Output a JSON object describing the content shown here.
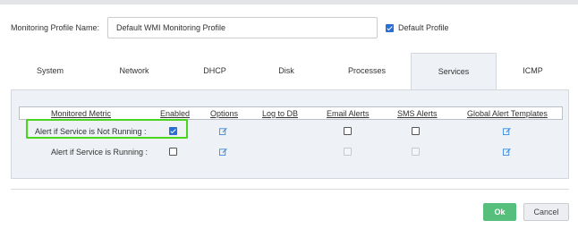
{
  "profile": {
    "name_label": "Monitoring Profile Name:",
    "name_value": "Default WMI Monitoring Profile",
    "default_label": "Default Profile",
    "default_checked": true
  },
  "tabs": [
    {
      "label": "System",
      "active": false
    },
    {
      "label": "Network",
      "active": false
    },
    {
      "label": "DHCP",
      "active": false
    },
    {
      "label": "Disk",
      "active": false
    },
    {
      "label": "Processes",
      "active": false
    },
    {
      "label": "Services",
      "active": true
    },
    {
      "label": "ICMP",
      "active": false
    }
  ],
  "table": {
    "headers": {
      "metric": "Monitored Metric",
      "enabled": "Enabled",
      "options": "Options",
      "log": "Log to DB",
      "email": "Email Alerts",
      "sms": "SMS Alerts",
      "global": "Global Alert Templates"
    },
    "rows": [
      {
        "label": "Alert if Service is Not Running :",
        "enabled": true,
        "email": false,
        "sms": false
      },
      {
        "label": "Alert if Service is Running :",
        "enabled": false,
        "email": false,
        "sms": false
      }
    ]
  },
  "buttons": {
    "ok": "Ok",
    "cancel": "Cancel"
  },
  "colors": {
    "accent": "#2a6fd6",
    "ok_green": "#57bf7c",
    "highlight": "#4ad61e"
  },
  "icons": {
    "edit": "edit-icon"
  }
}
